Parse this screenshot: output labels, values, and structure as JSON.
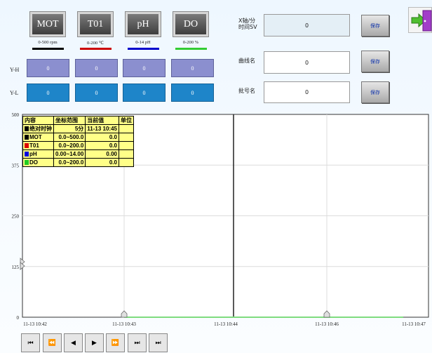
{
  "sensors": [
    {
      "label": "MOT",
      "range": "0-500 rpm",
      "color": "#000000",
      "yh": "0",
      "yl": "0"
    },
    {
      "label": "T01",
      "range": "0-200 ℃",
      "color": "#cc0000",
      "yh": "0",
      "yl": "0"
    },
    {
      "label": "pH",
      "range": "0-14 pH",
      "color": "#0000cc",
      "yh": "0",
      "yl": "0"
    },
    {
      "label": "DO",
      "range": "0-200 %",
      "color": "#33cc33",
      "yh": "0",
      "yl": "0"
    }
  ],
  "rows": {
    "yh": "Y-H",
    "yl": "Y-L"
  },
  "fields": [
    {
      "label": "X轴/分\n时间SV",
      "value": "0",
      "save": "保存"
    },
    {
      "label": "曲线名",
      "value": "0",
      "save": "保存"
    },
    {
      "label": "批号名",
      "value": "0",
      "save": "保存"
    }
  ],
  "legend": {
    "headers": [
      "内容",
      "坐标范围",
      "当前值",
      "单位"
    ],
    "rows": [
      {
        "name": "绝对时钟",
        "range": "5分",
        "value": "11-13 10:45",
        "unit": "",
        "color": "#000000"
      },
      {
        "name": "MOT",
        "range": "0.0~500.0",
        "value": "0.0",
        "unit": "",
        "color": "#000000"
      },
      {
        "name": "T01",
        "range": "0.0~200.0",
        "value": "0.0",
        "unit": "",
        "color": "#dd0000"
      },
      {
        "name": "pH",
        "range": "0.00~14.00",
        "value": "0.00",
        "unit": "",
        "color": "#0000dd"
      },
      {
        "name": "DO",
        "range": "0.0~200.0",
        "value": "0.0",
        "unit": "",
        "color": "#22cc22"
      }
    ]
  },
  "chart_data": {
    "type": "line",
    "y_ticks": [
      "500",
      "375",
      "250",
      "125",
      "0"
    ],
    "x_ticks": [
      "11-13 10:42",
      "11-13 10:43",
      "11-13 10:44",
      "11-13 10:46",
      "11-13 10:47"
    ],
    "ylim": [
      0,
      500
    ],
    "series": [
      {
        "name": "DO",
        "color": "#7fdc7f",
        "values": [
          0,
          0,
          0,
          0,
          0
        ]
      }
    ]
  },
  "nav": [
    "⏮",
    "⏪",
    "◀",
    "▶",
    "⏩",
    "⏭",
    "⏭"
  ]
}
